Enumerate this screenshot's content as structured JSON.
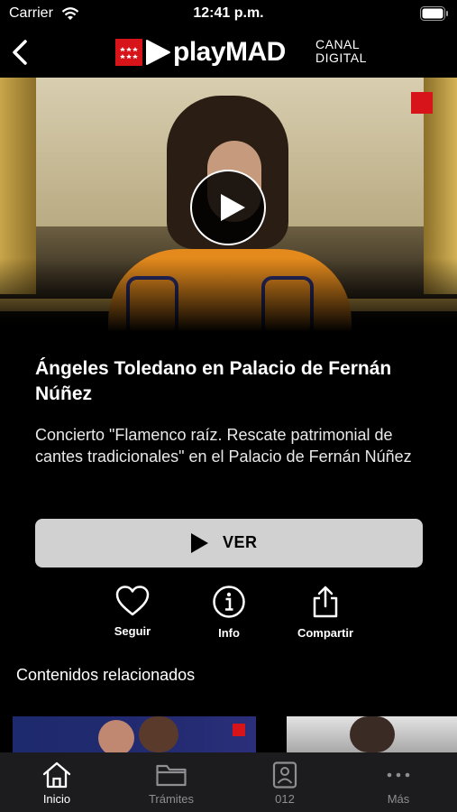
{
  "status_bar": {
    "carrier": "Carrier",
    "time": "12:41 p.m."
  },
  "header": {
    "brand_name": "playMAD",
    "brand_sub_1": "CANAL",
    "brand_sub_2": "DIGITAL"
  },
  "video": {
    "title": "Ángeles Toledano en Palacio de Fernán Núñez",
    "description": "Concierto \"Flamenco raíz. Rescate patrimonial de cantes tradicionales\" en el Palacio de Fernán Núñez"
  },
  "actions": {
    "watch": "VER",
    "follow": "Seguir",
    "info": "Info",
    "share": "Compartir"
  },
  "related": {
    "heading": "Contenidos relacionados"
  },
  "tabs": [
    {
      "label": "Inicio",
      "icon": "home-icon",
      "active": true
    },
    {
      "label": "Trámites",
      "icon": "folder-icon",
      "active": false
    },
    {
      "label": "012",
      "icon": "contact-card-icon",
      "active": false
    },
    {
      "label": "Más",
      "icon": "more-dots-icon",
      "active": false
    }
  ],
  "colors": {
    "brand_red": "#d7141a",
    "button_gray": "#d1d1d1",
    "tabbar_bg": "#1c1c1e"
  }
}
